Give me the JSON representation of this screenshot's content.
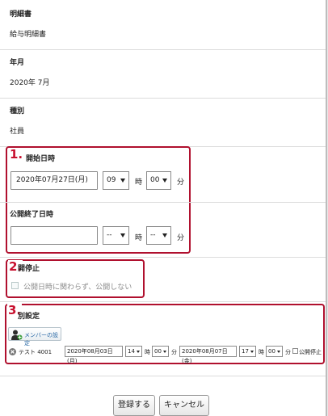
{
  "details": {
    "statement_label": "明細書",
    "statement_value": "給与明細書",
    "year_month_label": "年月",
    "year_month_value": "2020年 7月",
    "type_label": "種別",
    "type_value": "社員"
  },
  "annotations": {
    "one": "1.",
    "two": "2.",
    "three": "3."
  },
  "publish_start": {
    "label": "開始日時",
    "date": "2020年07月27日(月)",
    "hour": "09",
    "hour_unit": "時",
    "minute": "00",
    "minute_unit": "分"
  },
  "publish_end": {
    "label": "公開終了日時",
    "date": "",
    "hour": "--",
    "hour_unit": "時",
    "minute": "--",
    "minute_unit": "分"
  },
  "publish_stop": {
    "label": "開停止",
    "checkbox_label": "公開日時に関わらず、公開しない"
  },
  "individual_setting": {
    "label": "別設定",
    "member_button": "メンバーの設定",
    "row": {
      "name": "テスト 4001",
      "start_date": "2020年08月03日(月)",
      "start_hour": "14",
      "hour_unit": "時",
      "start_minute": "00",
      "minute_unit": "分",
      "end_date": "2020年08月07日(金)",
      "end_hour": "17",
      "end_minute": "00",
      "stop_label": "公開停止"
    }
  },
  "actions": {
    "register": "登録する",
    "cancel": "キャンセル"
  },
  "colors": {
    "annotation": "#c8102e",
    "link": "#2b6aa6"
  }
}
